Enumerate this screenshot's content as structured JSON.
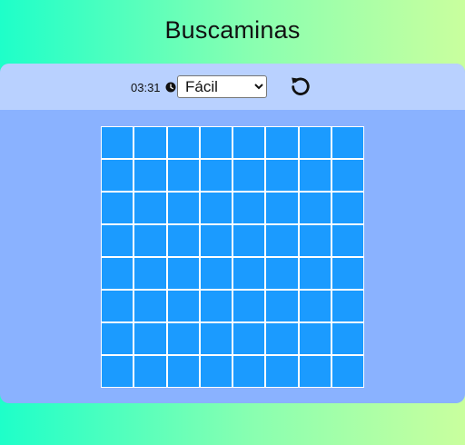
{
  "title": "Buscaminas",
  "toolbar": {
    "time": "03:31",
    "clock_icon": "clock-icon",
    "difficulty": {
      "selected": "Fácil",
      "options": [
        "Fácil"
      ]
    },
    "reset_icon": "reset-icon"
  },
  "board": {
    "rows": 8,
    "cols": 8,
    "cell_color": "#1b9bff"
  },
  "colors": {
    "panel": "#8ab2ff",
    "toolbar": "#b9d1ff"
  }
}
